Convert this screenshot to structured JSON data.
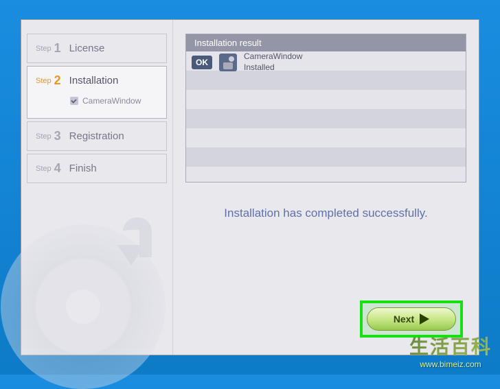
{
  "sidebar": {
    "steps": [
      {
        "prefix": "Step",
        "num": "1",
        "title": "License"
      },
      {
        "prefix": "Step",
        "num": "2",
        "title": "Installation",
        "sub": "CameraWindow"
      },
      {
        "prefix": "Step",
        "num": "3",
        "title": "Registration"
      },
      {
        "prefix": "Step",
        "num": "4",
        "title": "Finish"
      }
    ]
  },
  "result": {
    "header": "Installation result",
    "ok_badge": "OK",
    "items": [
      {
        "name": "CameraWindow",
        "status": "Installed"
      }
    ]
  },
  "completion_message": "Installation has completed successfully.",
  "buttons": {
    "next": "Next"
  },
  "watermark": {
    "title": "生活百科",
    "url": "www.bimeiz.com"
  }
}
